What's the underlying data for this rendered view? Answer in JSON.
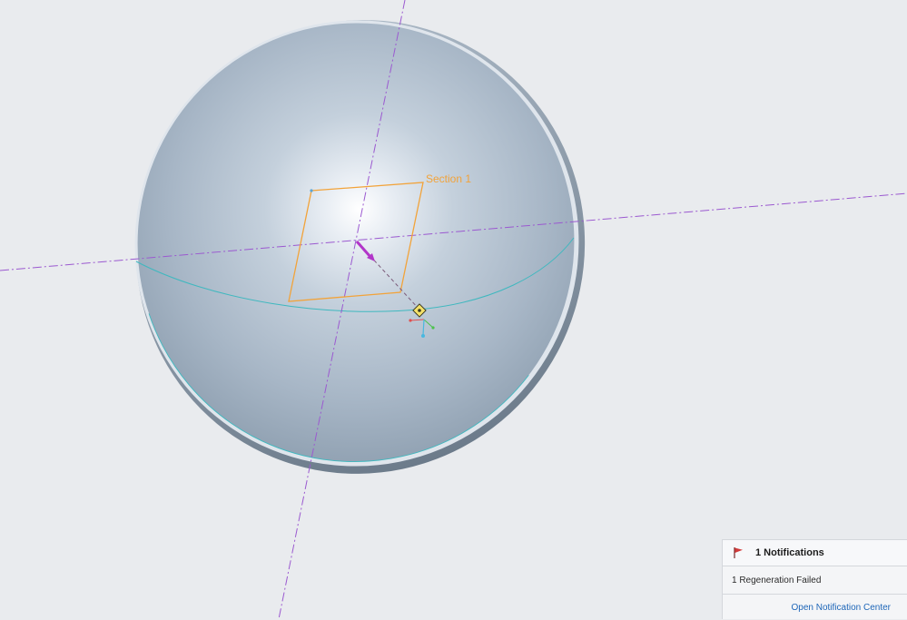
{
  "viewport": {
    "section_label": "Section 1"
  },
  "notifications": {
    "title": "1 Notifications",
    "message": "1 Regeneration Failed",
    "link_label": "Open Notification Center",
    "flag_icon": "red-flag-icon",
    "flag_color": "#d23b3b",
    "link_color": "#1e66b8"
  },
  "colors": {
    "background": "#e9ebee",
    "datum_axis": "#9b59d0",
    "section_sketch": "#f2a33a",
    "model_edge": "#3fb8bf",
    "direction_arrow": "#b236c9"
  }
}
